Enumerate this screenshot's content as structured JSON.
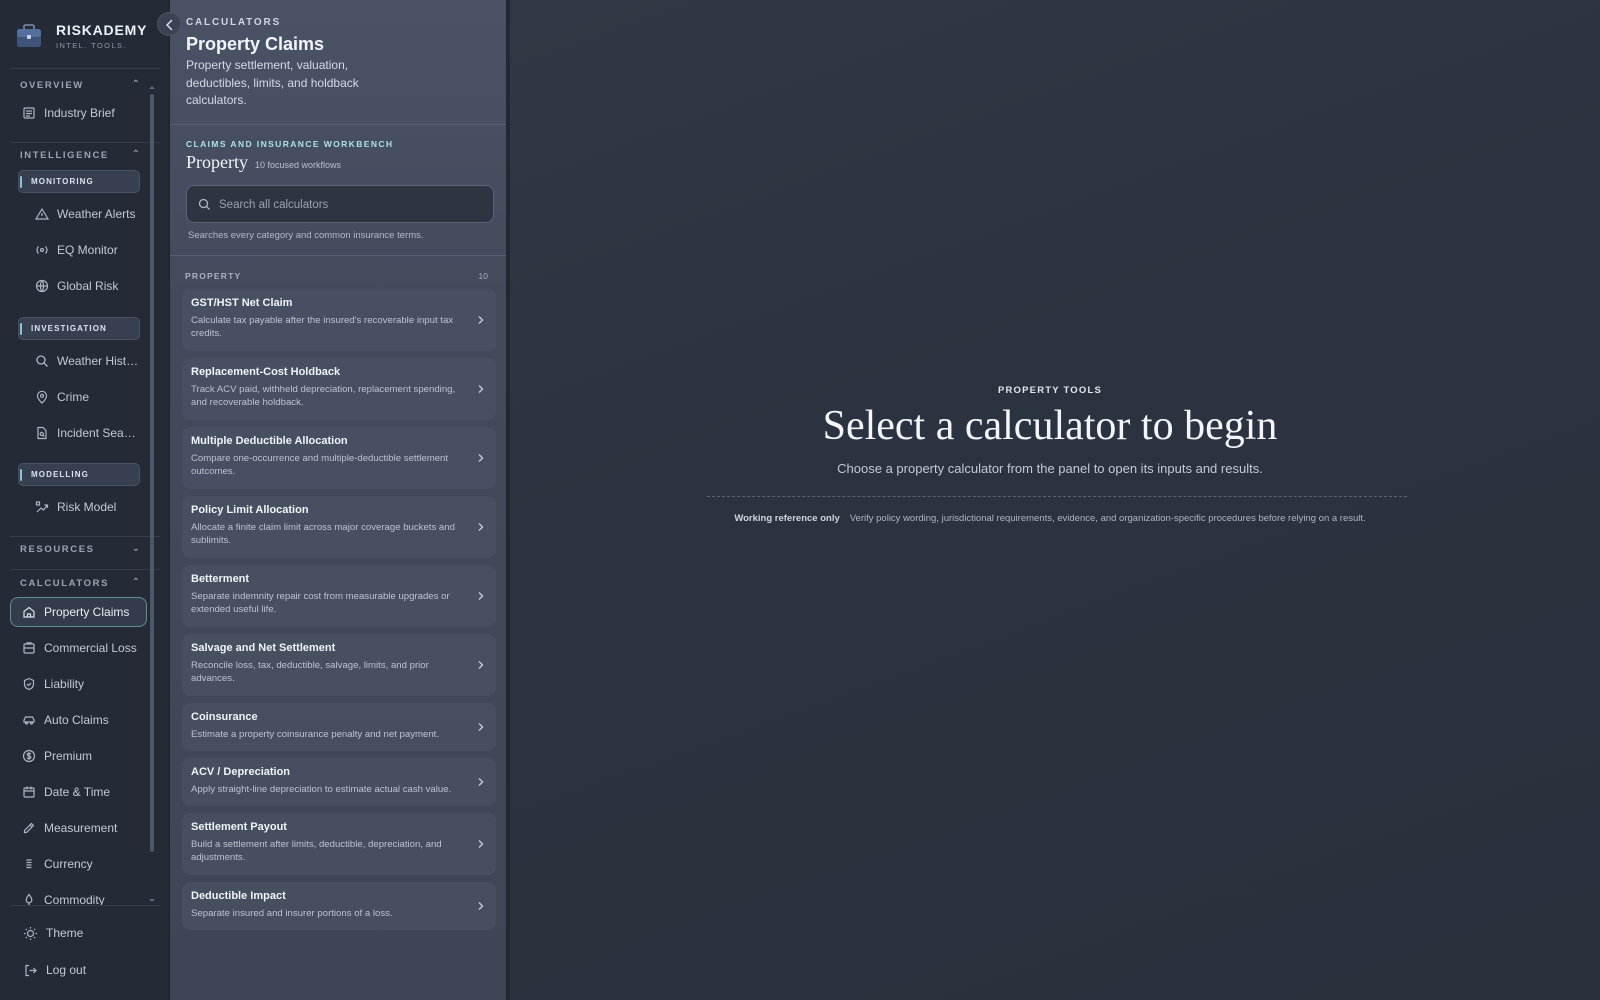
{
  "brand": {
    "name": "RISKADEMY",
    "tagline": "INTEL. TOOLS."
  },
  "sidebar": {
    "overview": {
      "label": "OVERVIEW",
      "items": [
        {
          "label": "Industry Brief",
          "icon": "newspaper-icon"
        }
      ]
    },
    "intelligence": {
      "label": "INTELLIGENCE",
      "groups": [
        {
          "label": "MONITORING",
          "items": [
            {
              "label": "Weather Alerts",
              "icon": "warning-icon"
            },
            {
              "label": "EQ Monitor",
              "icon": "radar-icon"
            },
            {
              "label": "Global Risk",
              "icon": "globe-icon"
            }
          ]
        },
        {
          "label": "INVESTIGATION",
          "items": [
            {
              "label": "Weather Hist…",
              "icon": "search-icon"
            },
            {
              "label": "Crime",
              "icon": "map-pin-icon"
            },
            {
              "label": "Incident Sea…",
              "icon": "file-search-icon"
            }
          ]
        },
        {
          "label": "MODELLING",
          "items": [
            {
              "label": "Risk Model",
              "icon": "trend-chart-icon"
            }
          ]
        }
      ]
    },
    "resources": {
      "label": "RESOURCES"
    },
    "calculators": {
      "label": "CALCULATORS",
      "items": [
        {
          "label": "Property Claims",
          "icon": "house-icon",
          "active": true
        },
        {
          "label": "Commercial Loss",
          "icon": "building-icon"
        },
        {
          "label": "Liability",
          "icon": "shield-icon"
        },
        {
          "label": "Auto Claims",
          "icon": "car-icon"
        },
        {
          "label": "Premium",
          "icon": "dollar-circle-icon"
        },
        {
          "label": "Date & Time",
          "icon": "calendar-icon"
        },
        {
          "label": "Measurement",
          "icon": "ruler-pencil-icon"
        },
        {
          "label": "Currency",
          "icon": "coins-icon"
        },
        {
          "label": "Commodity",
          "icon": "gem-icon"
        }
      ]
    },
    "footer": {
      "theme": "Theme",
      "logout": "Log out"
    }
  },
  "panel": {
    "eyebrow": "CALCULATORS",
    "title": "Property Claims",
    "description": "Property settlement, valuation, deductibles, limits, and holdback calculators.",
    "workbench_eyebrow": "CLAIMS AND INSURANCE WORKBENCH",
    "workbench_title": "Property",
    "workbench_count": "10 focused workflows",
    "search_placeholder": "Search all calculators",
    "search_hint": "Searches every category and common insurance terms.",
    "category": "PROPERTY",
    "category_count": "10",
    "calculators": [
      {
        "title": "GST/HST Net Claim",
        "desc": "Calculate tax payable after the insured's recoverable input tax credits."
      },
      {
        "title": "Replacement-Cost Holdback",
        "desc": "Track ACV paid, withheld depreciation, replacement spending, and recoverable holdback."
      },
      {
        "title": "Multiple Deductible Allocation",
        "desc": "Compare one-occurrence and multiple-deductible settlement outcomes."
      },
      {
        "title": "Policy Limit Allocation",
        "desc": "Allocate a finite claim limit across major coverage buckets and sublimits."
      },
      {
        "title": "Betterment",
        "desc": "Separate indemnity repair cost from measurable upgrades or extended useful life."
      },
      {
        "title": "Salvage and Net Settlement",
        "desc": "Reconcile loss, tax, deductible, salvage, limits, and prior advances."
      },
      {
        "title": "Coinsurance",
        "desc": "Estimate a property coinsurance penalty and net payment."
      },
      {
        "title": "ACV / Depreciation",
        "desc": "Apply straight-line depreciation to estimate actual cash value."
      },
      {
        "title": "Settlement Payout",
        "desc": "Build a settlement after limits, deductible, depreciation, and adjustments."
      },
      {
        "title": "Deductible Impact",
        "desc": "Separate insured and insurer portions of a loss."
      }
    ]
  },
  "main": {
    "eyebrow": "PROPERTY TOOLS",
    "title": "Select a calculator to begin",
    "subtitle": "Choose a property calculator from the panel to open its inputs and results.",
    "note_label": "Working reference only",
    "note_text": "Verify policy wording, jurisdictional requirements, evidence, and organization-specific procedures before relying on a result."
  },
  "colors": {
    "accent": "#8fc5d0",
    "active_border": "#5f8c95",
    "sidebar_bg": "#242b37",
    "panel_bg": "#464f61",
    "main_bg": "#2c3340"
  }
}
